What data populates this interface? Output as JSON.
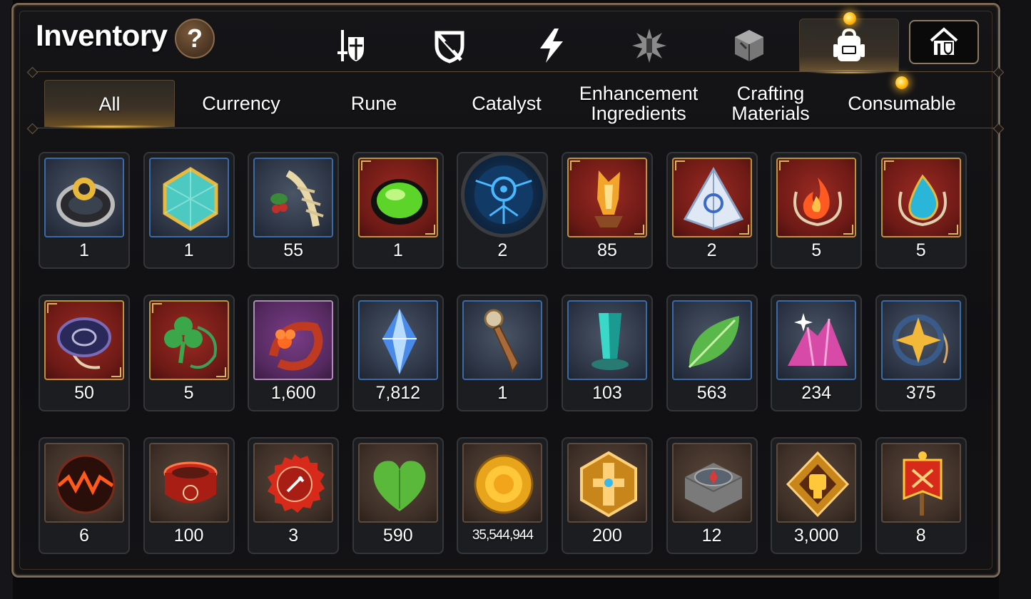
{
  "header": {
    "title": "Inventory",
    "help_label": "?",
    "category_icons": [
      {
        "name": "equipment-category-icon",
        "active": false
      },
      {
        "name": "broken-shield-category-icon",
        "active": false
      },
      {
        "name": "lightning-category-icon",
        "active": false
      },
      {
        "name": "burst-category-icon",
        "active": false
      },
      {
        "name": "cube-category-icon",
        "active": false
      },
      {
        "name": "backpack-category-icon",
        "active": true
      }
    ],
    "guild_button_icon": "guild-house-icon"
  },
  "tabs": [
    {
      "label": "All",
      "active": true
    },
    {
      "label": "Currency",
      "active": false
    },
    {
      "label": "Rune",
      "active": false
    },
    {
      "label": "Catalyst",
      "active": false
    },
    {
      "label": "Enhancement\nIngredients",
      "active": false
    },
    {
      "label": "Crafting\nMaterials",
      "active": false
    },
    {
      "label": "Consumable",
      "active": false
    }
  ],
  "items": [
    {
      "icon": "ring-icon",
      "frame": "blue",
      "count": "1"
    },
    {
      "icon": "gem-icon",
      "frame": "blue",
      "count": "1"
    },
    {
      "icon": "root-herb-icon",
      "frame": "blue",
      "count": "55"
    },
    {
      "icon": "green-orb-icon",
      "frame": "red",
      "count": "1"
    },
    {
      "icon": "rune-stone-icon",
      "frame": "round",
      "count": "2"
    },
    {
      "icon": "flame-crystal-icon",
      "frame": "red",
      "count": "85"
    },
    {
      "icon": "pyramid-crystal-icon",
      "frame": "red",
      "count": "2"
    },
    {
      "icon": "fire-amulet-icon",
      "frame": "red",
      "count": "5"
    },
    {
      "icon": "water-amulet-icon",
      "frame": "red",
      "count": "5"
    },
    {
      "icon": "disc-amulet-icon",
      "frame": "red",
      "count": "50"
    },
    {
      "icon": "clover-amulet-icon",
      "frame": "red",
      "count": "5"
    },
    {
      "icon": "flower-ring-icon",
      "frame": "purple",
      "count": "1,600"
    },
    {
      "icon": "blue-crystal-icon",
      "frame": "blue",
      "count": "7,812"
    },
    {
      "icon": "pendulum-icon",
      "frame": "blue",
      "count": "1"
    },
    {
      "icon": "teal-crystal-icon",
      "frame": "blue",
      "count": "103"
    },
    {
      "icon": "leaf-icon",
      "frame": "blue",
      "count": "563"
    },
    {
      "icon": "pink-ore-icon",
      "frame": "blue",
      "count": "234"
    },
    {
      "icon": "star-amulet-icon",
      "frame": "blue",
      "count": "375"
    },
    {
      "icon": "lava-orb-icon",
      "frame": "brown",
      "count": "6"
    },
    {
      "icon": "red-band-icon",
      "frame": "brown",
      "count": "100"
    },
    {
      "icon": "bottle-cap-icon",
      "frame": "brown",
      "count": "3"
    },
    {
      "icon": "green-heart-icon",
      "frame": "brown",
      "count": "590"
    },
    {
      "icon": "gold-coin-icon",
      "frame": "brown",
      "count": "35,544,944"
    },
    {
      "icon": "gold-emblem-icon",
      "frame": "brown",
      "count": "200"
    },
    {
      "icon": "stone-compass-icon",
      "frame": "brown",
      "count": "12"
    },
    {
      "icon": "fist-badge-icon",
      "frame": "brown",
      "count": "3,000"
    },
    {
      "icon": "banner-icon",
      "frame": "brown",
      "count": "8"
    }
  ],
  "colors": {
    "gold_accent": "#ffd35a",
    "frame_border": "#7a6a55",
    "blue_frame": "#3b6aa8",
    "red_frame": "#c0913c"
  }
}
